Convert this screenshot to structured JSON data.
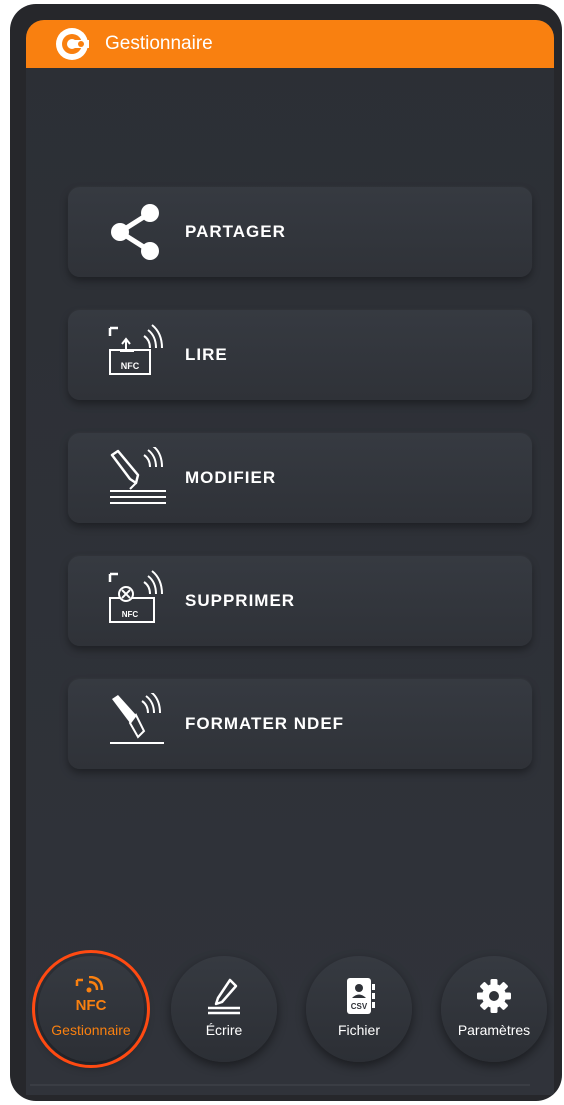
{
  "header": {
    "title": "Gestionnaire",
    "logo_icon": "c-logo-icon",
    "background_color": "#f98010"
  },
  "menu": {
    "items": [
      {
        "label": "PARTAGER",
        "icon": "share-icon"
      },
      {
        "label": "LIRE",
        "icon": "nfc-read-icon"
      },
      {
        "label": "MODIFIER",
        "icon": "nfc-edit-icon"
      },
      {
        "label": "SUPPRIMER",
        "icon": "nfc-delete-icon"
      },
      {
        "label": "FORMATER NDEF",
        "icon": "nfc-format-icon"
      }
    ]
  },
  "bottom_nav": {
    "items": [
      {
        "label": "Gestionnaire",
        "icon": "nfc-icon",
        "icon_text": "NFC",
        "active": true
      },
      {
        "label": "Écrire",
        "icon": "pencil-write-icon",
        "active": false
      },
      {
        "label": "Fichier",
        "icon": "csv-file-icon",
        "icon_text": "CSV",
        "active": false
      },
      {
        "label": "Paramètres",
        "icon": "gear-icon",
        "active": false
      }
    ],
    "active_color": "#f98010"
  }
}
